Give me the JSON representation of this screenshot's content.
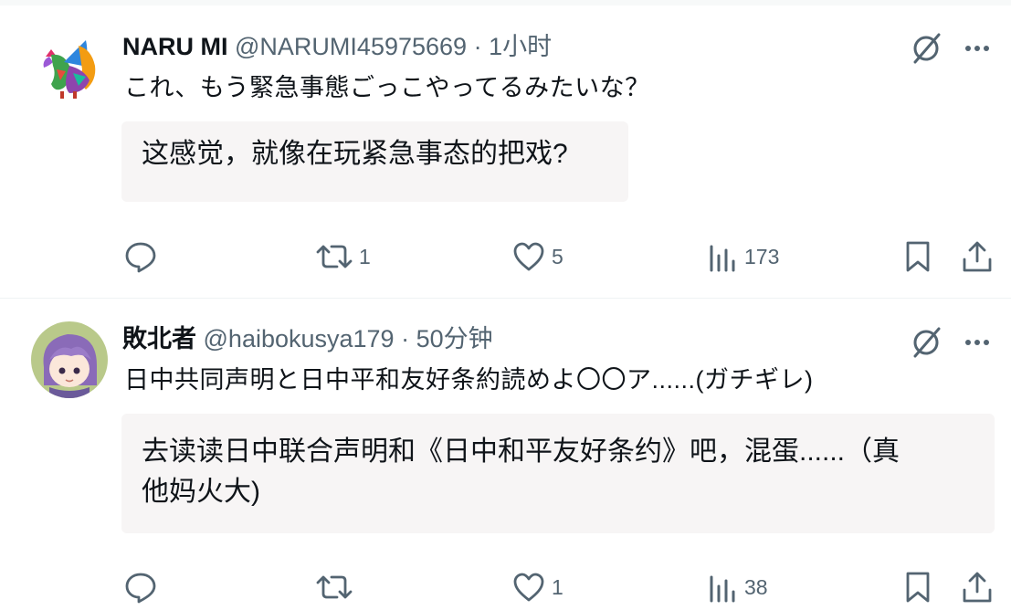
{
  "tweets": [
    {
      "name": "NARU MI",
      "handle": "@NARUMI45975669",
      "time": "1小时",
      "text": "これ、もう緊急事態ごっこやってるみたいな？",
      "translation": "这感觉，就像在玩紧急事态的把戏?",
      "actions": {
        "reply": "",
        "retweet": "1",
        "like": "5",
        "views": "173"
      },
      "avatar": "rooster-avatar"
    },
    {
      "name": "敗北者",
      "handle": "@haibokusya179",
      "time": "50分钟",
      "text": "日中共同声明と日中平和友好条約読めよ〇〇ア......(ガチギレ)",
      "translation_line1": "去读读日中联合声明和《日中和平友好条约》吧，混蛋......（真",
      "translation_line2": "他妈火大)",
      "actions": {
        "reply": "",
        "retweet": "",
        "like": "1",
        "views": "38"
      },
      "avatar": "anime-girl-avatar"
    }
  ],
  "colors": {
    "text": "#0f1419",
    "meta": "#536471",
    "translation_bg": "#f7f5f5",
    "divider": "#eff3f4"
  },
  "icons": [
    "grok-slash-icon",
    "more-icon",
    "reply-icon",
    "retweet-icon",
    "like-icon",
    "views-icon",
    "bookmark-icon",
    "share-icon"
  ]
}
